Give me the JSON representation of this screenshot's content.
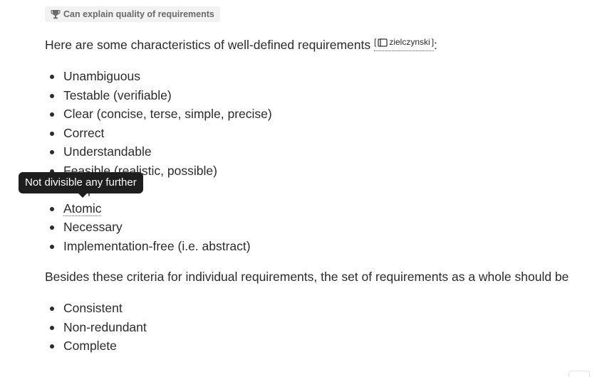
{
  "badge": {
    "icon": "trophy-icon",
    "label": "Can explain quality of requirements"
  },
  "intro": {
    "text": "Here are some characteristics of well-defined requirements ",
    "citation_open": "[",
    "citation_icon": "book-icon",
    "citation_label": "zielczynski",
    "citation_close": "]",
    "tail": ":"
  },
  "list1": [
    "Unambiguous",
    "Testable (verifiable)",
    "Clear (concise, terse, simple, precise)",
    "Correct",
    "Understandable",
    "Feasible (realistic, possible)",
    "Independent",
    "Atomic",
    "Necessary",
    "Implementation-free (i.e. abstract)"
  ],
  "tooltip": {
    "text": "Not divisible any further"
  },
  "para2": "Besides these criteria for individual requirements, the set of requirements as a whole should be",
  "list2": [
    "Consistent",
    "Non-redundant",
    "Complete"
  ]
}
